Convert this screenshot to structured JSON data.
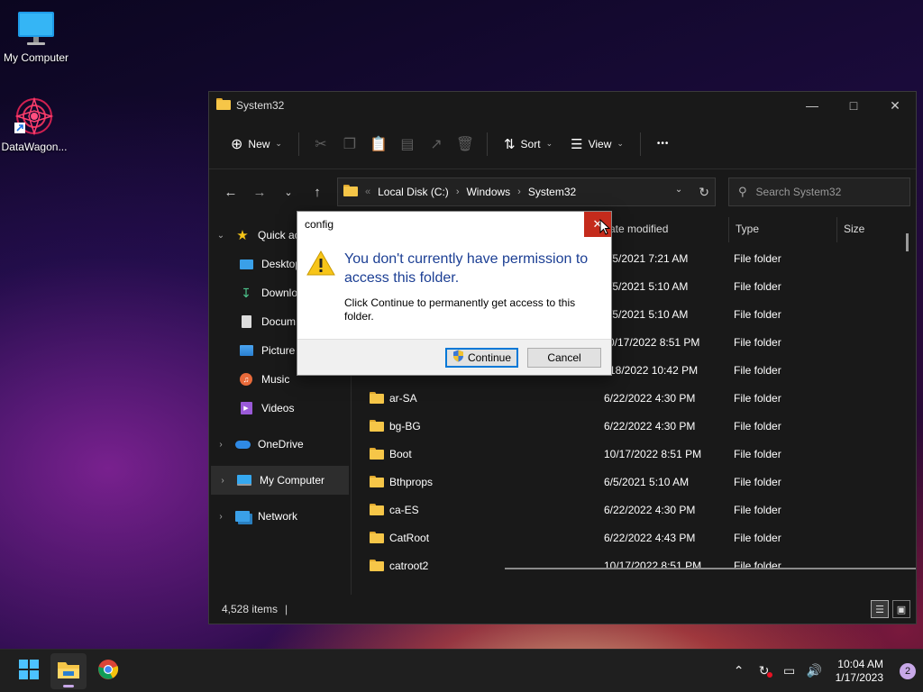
{
  "desktop": {
    "icons": [
      {
        "label": "My Computer"
      },
      {
        "label": "DataWagon..."
      }
    ]
  },
  "explorer": {
    "title": "System32",
    "toolbar": {
      "new_label": "New",
      "sort_label": "Sort",
      "view_label": "View",
      "more_label": "•••"
    },
    "breadcrumb": [
      "Local Disk (C:)",
      "Windows",
      "System32"
    ],
    "search_placeholder": "Search System32",
    "columns": {
      "date": "ate modified",
      "type": "Type",
      "size": "Size"
    },
    "sidebar": {
      "quick_access": "Quick ac",
      "items": [
        "Desktop",
        "Downlo",
        "Docum",
        "Picture",
        "Music",
        "Videos"
      ],
      "onedrive": "OneDrive",
      "my_computer": "My Computer",
      "network": "Network"
    },
    "partial_rows": [
      {
        "date": "/5/2021 7:21 AM",
        "type": "File folder"
      },
      {
        "date": "/5/2021 5:10 AM",
        "type": "File folder"
      },
      {
        "date": "/5/2021 5:10 AM",
        "type": "File folder"
      },
      {
        "date": "0/17/2022 8:51 PM",
        "type": "File folder"
      },
      {
        "date": "18/2022 10:42 PM",
        "type": "File folder"
      }
    ],
    "rows": [
      {
        "name": "ar-SA",
        "date": "6/22/2022 4:30 PM",
        "type": "File folder"
      },
      {
        "name": "bg-BG",
        "date": "6/22/2022 4:30 PM",
        "type": "File folder"
      },
      {
        "name": "Boot",
        "date": "10/17/2022 8:51 PM",
        "type": "File folder"
      },
      {
        "name": "Bthprops",
        "date": "6/5/2021 5:10 AM",
        "type": "File folder"
      },
      {
        "name": "ca-ES",
        "date": "6/22/2022 4:30 PM",
        "type": "File folder"
      },
      {
        "name": "CatRoot",
        "date": "6/22/2022 4:43 PM",
        "type": "File folder"
      },
      {
        "name": "catroot2",
        "date": "10/17/2022 8:51 PM",
        "type": "File folder"
      }
    ],
    "status": "4,528 items"
  },
  "dialog": {
    "title": "config",
    "heading": "You don't currently have permission to access this folder.",
    "message": "Click Continue to permanently get access to this folder.",
    "continue_label": "Continue",
    "cancel_label": "Cancel"
  },
  "taskbar": {
    "time": "10:04 AM",
    "date": "1/17/2023",
    "notification_count": "2"
  },
  "colors": {
    "accent": "#0078d7",
    "close_red": "#c42b1c",
    "folder_yellow": "#f6c648",
    "dialog_heading": "#1c3f94"
  }
}
